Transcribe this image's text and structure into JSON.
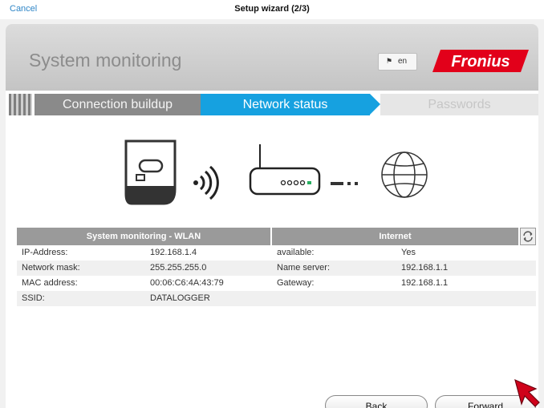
{
  "topbar": {
    "cancel_label": "Cancel",
    "title": "Setup wizard (2/3)"
  },
  "panel": {
    "title": "System monitoring",
    "language": "en",
    "logo_text": "Fronius"
  },
  "steps": [
    {
      "label": "Connection buildup",
      "state": "done"
    },
    {
      "label": "Network status",
      "state": "active"
    },
    {
      "label": "Passwords",
      "state": "pending"
    }
  ],
  "illustration": {
    "icons": [
      "inverter-icon",
      "wifi-signal-icon",
      "router-icon",
      "connection-dots-icon",
      "globe-icon"
    ]
  },
  "wlan": {
    "header": "System monitoring - WLAN",
    "rows": [
      {
        "label": "IP-Address:",
        "value": "192.168.1.4"
      },
      {
        "label": "Network mask:",
        "value": "255.255.255.0"
      },
      {
        "label": "MAC address:",
        "value": "00:06:C6:4A:43:79"
      },
      {
        "label": "SSID:",
        "value": "DATALOGGER"
      }
    ]
  },
  "internet": {
    "header": "Internet",
    "rows": [
      {
        "label": "available:",
        "value": "Yes"
      },
      {
        "label": "Name server:",
        "value": "192.168.1.1"
      },
      {
        "label": "Gateway:",
        "value": "192.168.1.1"
      },
      {
        "label": "",
        "value": ""
      }
    ]
  },
  "buttons": {
    "back": "Back",
    "forward": "Forward"
  },
  "colors": {
    "accent": "#16a1e0",
    "brand": "#e2001a",
    "header_gray": "#9a9a9a",
    "link": "#2f86c7"
  }
}
